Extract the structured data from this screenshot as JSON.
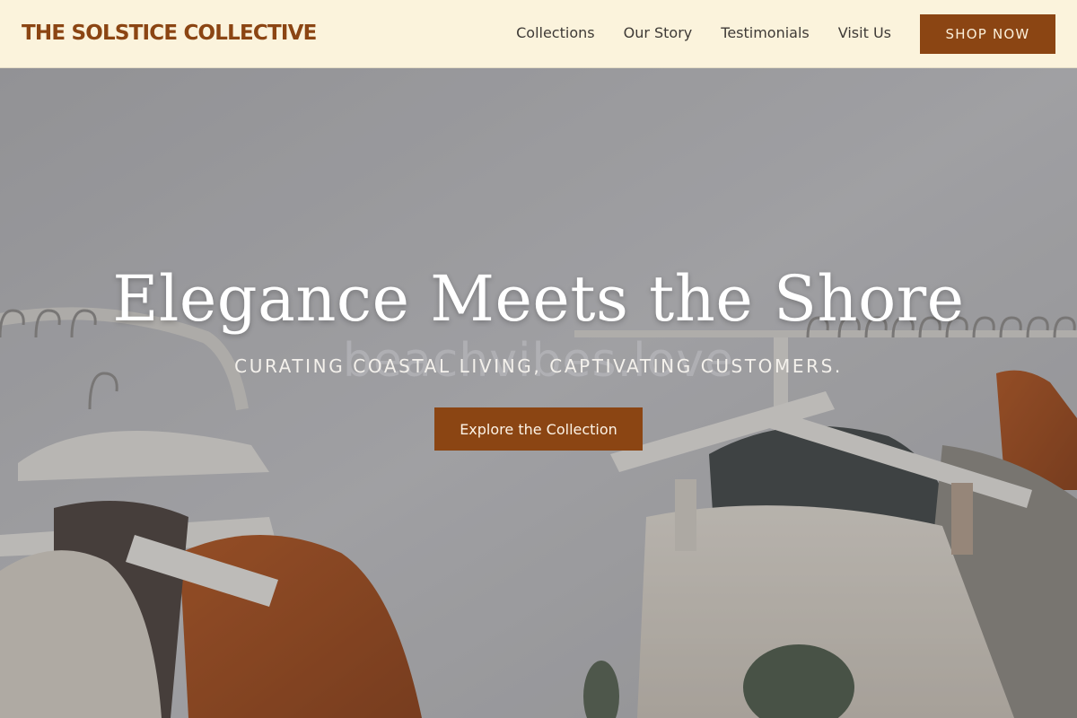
{
  "header": {
    "brand": "THE SOLSTICE COLLECTIVE",
    "nav": [
      {
        "label": "Collections"
      },
      {
        "label": "Our Story"
      },
      {
        "label": "Testimonials"
      },
      {
        "label": "Visit Us"
      }
    ],
    "cta_label": "SHOP NOW"
  },
  "hero": {
    "title": "Elegance Meets the Shore",
    "subtitle": "CURATING COASTAL LIVING, CAPTIVATING CUSTOMERS.",
    "button_label": "Explore the Collection",
    "watermark": "beachvibes.love"
  },
  "colors": {
    "header_bg": "#fbf3dc",
    "accent": "#8b4513",
    "hero_text": "#ffffff"
  }
}
